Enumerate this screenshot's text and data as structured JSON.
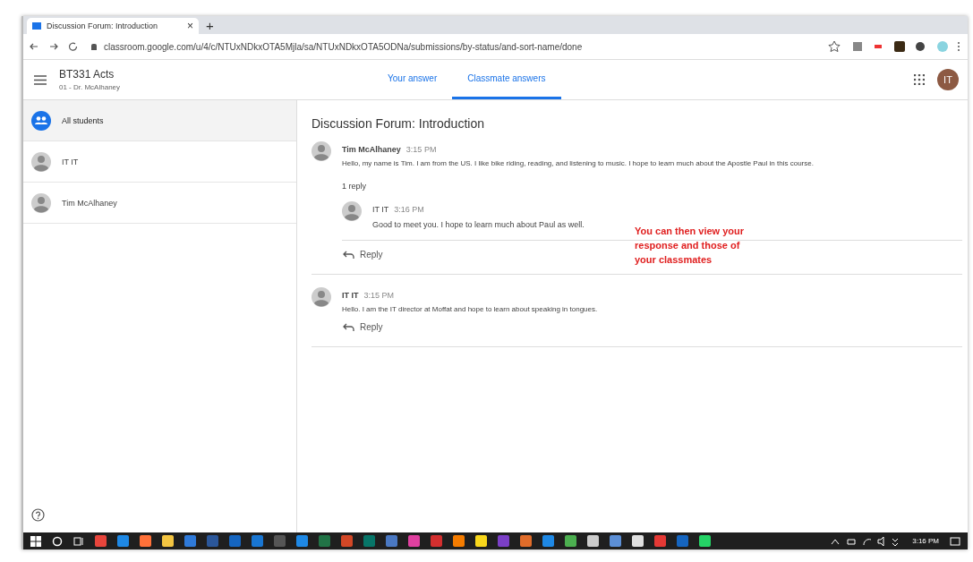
{
  "browser": {
    "tab_title": "Discussion Forum: Introduction",
    "tab_close": "×",
    "new_tab": "+",
    "url": "classroom.google.com/u/4/c/NTUxNDkxOTA5Mjla/sa/NTUxNDkxOTA5ODNa/submissions/by-status/and-sort-name/done"
  },
  "header": {
    "course": "BT331 Acts",
    "subtitle": "01 - Dr. McAlhaney",
    "avatar": "IT"
  },
  "tabs": [
    {
      "label": "Your answer",
      "selected": false
    },
    {
      "label": "Classmate answers",
      "selected": true
    }
  ],
  "sidebar": {
    "items": [
      {
        "label": "All students",
        "kind": "group",
        "selected": true
      },
      {
        "label": "IT IT",
        "kind": "person",
        "selected": false
      },
      {
        "label": "Tim McAlhaney",
        "kind": "person",
        "selected": false
      }
    ]
  },
  "forum": {
    "title": "Discussion Forum: Introduction",
    "posts": [
      {
        "author": "Tim McAlhaney",
        "time": "3:15 PM",
        "text": "Hello, my name is Tim. I am from the US. I like bike riding, reading, and listening to music. I hope to learn much about the Apostle Paul in this course.",
        "reply_count": "1 reply",
        "replies": [
          {
            "author": "IT IT",
            "time": "3:16 PM",
            "text": "Good to meet you. I hope to learn much about Paul as well."
          }
        ],
        "reply_label": "Reply"
      },
      {
        "author": "IT IT",
        "time": "3:15 PM",
        "text": "Hello. I am the IT director at Moffat and hope to learn about speaking in tongues.",
        "reply_label": "Reply"
      }
    ]
  },
  "annotation": "You can then view your response and those of your classmates",
  "taskbar": {
    "apps": [
      {
        "color": "#e8453c"
      },
      {
        "color": "#1e88e5"
      },
      {
        "color": "#ff7139"
      },
      {
        "color": "#f4c542"
      },
      {
        "color": "#2f7ad9"
      },
      {
        "color": "#2b579a"
      },
      {
        "color": "#1565c0"
      },
      {
        "color": "#1976d2"
      },
      {
        "color": "#555555"
      },
      {
        "color": "#1e88e5"
      },
      {
        "color": "#217346"
      },
      {
        "color": "#d24726"
      },
      {
        "color": "#077568"
      },
      {
        "color": "#4a78c2"
      },
      {
        "color": "#e040a0"
      },
      {
        "color": "#d32f2f"
      },
      {
        "color": "#f57c00"
      },
      {
        "color": "#f9d71c"
      },
      {
        "color": "#7b3fc7"
      },
      {
        "color": "#e06c2a"
      },
      {
        "color": "#1e88e5"
      },
      {
        "color": "#4caf50"
      },
      {
        "color": "#cccccc"
      },
      {
        "color": "#5c8fd6"
      },
      {
        "color": "#e0e0e0"
      },
      {
        "color": "#e53935"
      },
      {
        "color": "#1565c0"
      },
      {
        "color": "#25d366"
      }
    ],
    "clock": "3:16 PM"
  }
}
